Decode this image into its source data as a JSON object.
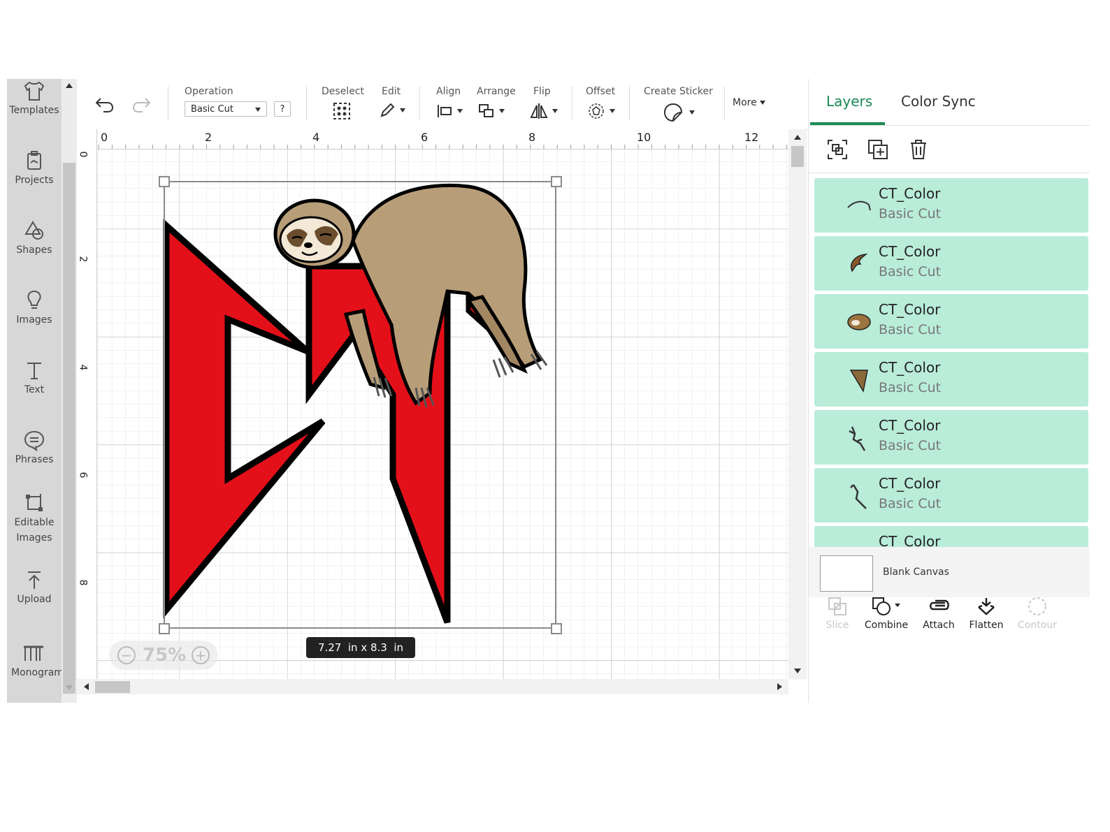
{
  "sidebar": {
    "items": [
      {
        "label": "Templates",
        "icon": "shirt-icon"
      },
      {
        "label": "Projects",
        "icon": "clipboard-icon"
      },
      {
        "label": "Shapes",
        "icon": "shapes-icon"
      },
      {
        "label": "Images",
        "icon": "lightbulb-icon"
      },
      {
        "label": "Text",
        "icon": "text-t-icon"
      },
      {
        "label": "Phrases",
        "icon": "speech-bubble-icon"
      },
      {
        "label": "Editable Images",
        "icon": "editable-image-icon"
      },
      {
        "label": "Upload",
        "icon": "upload-arrow-icon"
      },
      {
        "label": "Monogram",
        "icon": "monogram-icon"
      }
    ]
  },
  "toolbar": {
    "undo_icon": "undo-icon",
    "redo_icon": "redo-icon",
    "operation_label": "Operation",
    "operation_value": "Basic Cut",
    "help_label": "?",
    "deselect_label": "Deselect",
    "edit_label": "Edit",
    "align_label": "Align",
    "arrange_label": "Arrange",
    "flip_label": "Flip",
    "offset_label": "Offset",
    "create_sticker_label": "Create Sticker",
    "more_label": "More"
  },
  "ruler": {
    "top_numbers": [
      "0",
      "2",
      "4",
      "6",
      "8",
      "10",
      "12"
    ],
    "left_numbers": [
      "0",
      "2",
      "4",
      "6",
      "8"
    ]
  },
  "canvas": {
    "design_text": "CT",
    "size_readout": "7.27  in x 8.3  in",
    "zoom": "75%",
    "colors": {
      "letter_red": "#e31019",
      "sloth_tan": "#b89e78",
      "grid": "#e3e3e3"
    }
  },
  "panel": {
    "tabs": [
      {
        "label": "Layers",
        "active": true
      },
      {
        "label": "Color Sync",
        "active": false
      }
    ],
    "actions": [
      "group-icon",
      "duplicate-icon",
      "delete-icon"
    ],
    "layers": [
      {
        "name": "CT_Color",
        "op": "Basic Cut",
        "thumb_color": "#333333"
      },
      {
        "name": "CT_Color",
        "op": "Basic Cut",
        "thumb_color": "#8a5a2b"
      },
      {
        "name": "CT_Color",
        "op": "Basic Cut",
        "thumb_color": "#9c7440"
      },
      {
        "name": "CT_Color",
        "op": "Basic Cut",
        "thumb_color": "#8a6a3a"
      },
      {
        "name": "CT_Color",
        "op": "Basic Cut",
        "thumb_color": "#333333"
      },
      {
        "name": "CT_Color",
        "op": "Basic Cut",
        "thumb_color": "#333333"
      },
      {
        "name": "CT_Color",
        "op": "",
        "thumb_color": "#8a6a3a"
      }
    ],
    "blank_canvas_label": "Blank Canvas",
    "bottom_actions": [
      {
        "label": "Slice",
        "enabled": false
      },
      {
        "label": "Combine",
        "enabled": true
      },
      {
        "label": "Attach",
        "enabled": true
      },
      {
        "label": "Flatten",
        "enabled": true
      },
      {
        "label": "Contour",
        "enabled": false
      }
    ],
    "accent_color": "#1b8a55",
    "layer_bg": "#b9ecd9"
  }
}
